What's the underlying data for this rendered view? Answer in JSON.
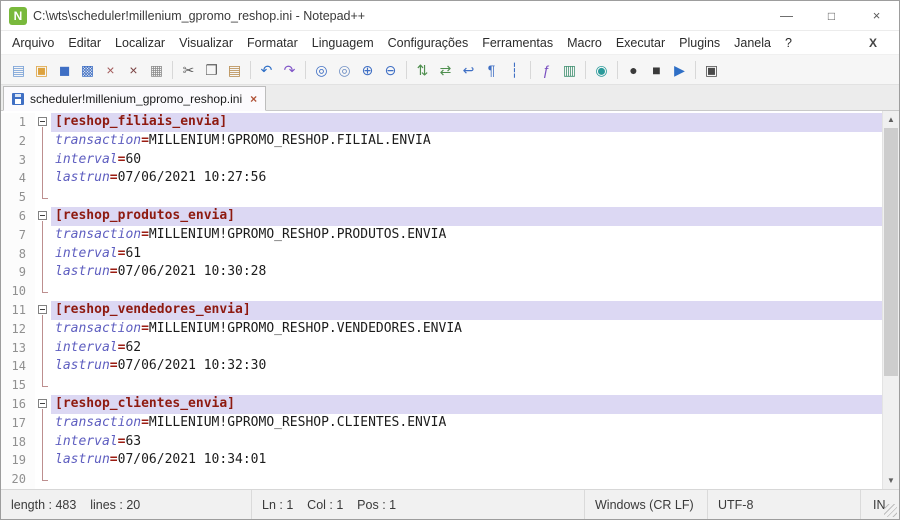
{
  "window": {
    "title": "C:\\wts\\scheduler!millenium_gpromo_reshop.ini - Notepad++",
    "controls": {
      "minimize": "—",
      "maximize": "□",
      "close": "×"
    }
  },
  "menubar": {
    "items": [
      "Arquivo",
      "Editar",
      "Localizar",
      "Visualizar",
      "Formatar",
      "Linguagem",
      "Configurações",
      "Ferramentas",
      "Macro",
      "Executar",
      "Plugins",
      "Janela",
      "?"
    ],
    "close_doc": "X"
  },
  "toolbar": {
    "groups": [
      [
        {
          "name": "new-file",
          "glyph": "▤",
          "color": "#6f9bd3"
        },
        {
          "name": "open-folder",
          "glyph": "▣",
          "color": "#dda23e"
        },
        {
          "name": "save",
          "glyph": "◼",
          "color": "#3f6fc4"
        },
        {
          "name": "save-all",
          "glyph": "▩",
          "color": "#3f6fc4"
        },
        {
          "name": "close-file",
          "glyph": "×",
          "color": "#a35b5b"
        },
        {
          "name": "close-all-files",
          "glyph": "×",
          "color": "#7a4343"
        },
        {
          "name": "print",
          "glyph": "▦",
          "color": "#8a8a8a"
        }
      ],
      [
        {
          "name": "cut",
          "glyph": "✂",
          "color": "#5f5f5f"
        },
        {
          "name": "copy",
          "glyph": "❐",
          "color": "#5f5f5f"
        },
        {
          "name": "paste",
          "glyph": "▤",
          "color": "#b5884a"
        }
      ],
      [
        {
          "name": "undo",
          "glyph": "↶",
          "color": "#2f6fc6"
        },
        {
          "name": "redo",
          "glyph": "↷",
          "color": "#8055c8"
        }
      ],
      [
        {
          "name": "find",
          "glyph": "◎",
          "color": "#3f6fc4"
        },
        {
          "name": "replace",
          "glyph": "◎",
          "color": "#6f8fc4"
        },
        {
          "name": "zoom-in",
          "glyph": "⊕",
          "color": "#3f6fc4"
        },
        {
          "name": "zoom-out",
          "glyph": "⊖",
          "color": "#3f6fc4"
        }
      ],
      [
        {
          "name": "sync-vertical",
          "glyph": "⇅",
          "color": "#4f8f4f"
        },
        {
          "name": "sync-horizontal",
          "glyph": "⇄",
          "color": "#4f8f4f"
        },
        {
          "name": "word-wrap",
          "glyph": "↩",
          "color": "#3f6fc4"
        },
        {
          "name": "show-all-characters",
          "glyph": "¶",
          "color": "#3f6fc4"
        },
        {
          "name": "show-indent-guide",
          "glyph": "┆",
          "color": "#3f6fc4"
        }
      ],
      [
        {
          "name": "function-list",
          "glyph": "ƒ",
          "color": "#7a4fc0"
        },
        {
          "name": "document-map",
          "glyph": "▥",
          "color": "#3f8f6f"
        }
      ],
      [
        {
          "name": "view-in-browser",
          "glyph": "◉",
          "color": "#2a9a9a"
        }
      ],
      [
        {
          "name": "record-macro",
          "glyph": "●",
          "color": "#3a3a3a"
        },
        {
          "name": "stop-recording",
          "glyph": "■",
          "color": "#3a3a3a"
        },
        {
          "name": "play-macro",
          "glyph": "▶",
          "color": "#2f6fc6"
        }
      ],
      [
        {
          "name": "document-monitor",
          "glyph": "▣",
          "color": "#4a4a4a"
        }
      ]
    ]
  },
  "tab": {
    "label": "scheduler!millenium_gpromo_reshop.ini",
    "close_glyph": "×"
  },
  "editor": {
    "equals_sign": "=",
    "lines": [
      {
        "n": 1,
        "kind": "section",
        "text": "[reshop_filiais_envia]",
        "fold": "open"
      },
      {
        "n": 2,
        "kind": "prop",
        "key": "transaction",
        "value": "MILLENIUM!GPROMO_RESHOP.FILIAL.ENVIA",
        "fold": "mid"
      },
      {
        "n": 3,
        "kind": "prop",
        "key": "interval",
        "value": "60",
        "fold": "mid"
      },
      {
        "n": 4,
        "kind": "prop",
        "key": "lastrun",
        "value": "07/06/2021 10:27:56",
        "fold": "mid"
      },
      {
        "n": 5,
        "kind": "blank",
        "fold": "end"
      },
      {
        "n": 6,
        "kind": "section",
        "text": "[reshop_produtos_envia]",
        "fold": "open"
      },
      {
        "n": 7,
        "kind": "prop",
        "key": "transaction",
        "value": "MILLENIUM!GPROMO_RESHOP.PRODUTOS.ENVIA",
        "fold": "mid"
      },
      {
        "n": 8,
        "kind": "prop",
        "key": "interval",
        "value": "61",
        "fold": "mid"
      },
      {
        "n": 9,
        "kind": "prop",
        "key": "lastrun",
        "value": "07/06/2021 10:30:28",
        "fold": "mid"
      },
      {
        "n": 10,
        "kind": "blank",
        "fold": "end"
      },
      {
        "n": 11,
        "kind": "section",
        "text": "[reshop_vendedores_envia]",
        "fold": "open"
      },
      {
        "n": 12,
        "kind": "prop",
        "key": "transaction",
        "value": "MILLENIUM!GPROMO_RESHOP.VENDEDORES.ENVIA",
        "fold": "mid"
      },
      {
        "n": 13,
        "kind": "prop",
        "key": "interval",
        "value": "62",
        "fold": "mid"
      },
      {
        "n": 14,
        "kind": "prop",
        "key": "lastrun",
        "value": "07/06/2021 10:32:30",
        "fold": "mid"
      },
      {
        "n": 15,
        "kind": "blank",
        "fold": "end"
      },
      {
        "n": 16,
        "kind": "section",
        "text": "[reshop_clientes_envia]",
        "fold": "open"
      },
      {
        "n": 17,
        "kind": "prop",
        "key": "transaction",
        "value": "MILLENIUM!GPROMO_RESHOP.CLIENTES.ENVIA",
        "fold": "mid"
      },
      {
        "n": 18,
        "kind": "prop",
        "key": "interval",
        "value": "63",
        "fold": "mid"
      },
      {
        "n": 19,
        "kind": "prop",
        "key": "lastrun",
        "value": "07/06/2021 10:34:01",
        "fold": "mid"
      },
      {
        "n": 20,
        "kind": "blank",
        "fold": "end"
      }
    ]
  },
  "scrollbar": {
    "up": "▲",
    "down": "▼"
  },
  "statusbar": {
    "doc_stats": "length : 483    lines : 20",
    "cursor": "Ln : 1    Col : 1    Pos : 1",
    "eol_format": "Windows (CR LF)",
    "encoding": "UTF-8",
    "typing_mode": "IN"
  },
  "colors": {
    "section_fg": "#8e1a10",
    "section_bg": "#dcd8f3",
    "key_fg": "#5e5ec0",
    "equals_fg": "#9b1c12",
    "value_fg": "#1c1c1c",
    "line_number_fg": "#909090",
    "fold_line": "#bd8f8f"
  }
}
